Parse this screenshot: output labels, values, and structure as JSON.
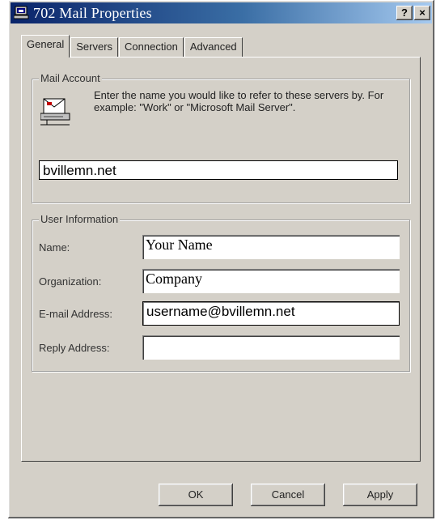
{
  "window": {
    "title": "702 Mail Properties",
    "help_button": "?",
    "close_button": "×"
  },
  "tabs": [
    {
      "label": "General",
      "active": true
    },
    {
      "label": "Servers",
      "active": false
    },
    {
      "label": "Connection",
      "active": false
    },
    {
      "label": "Advanced",
      "active": false
    }
  ],
  "mail_account": {
    "legend": "Mail Account",
    "instructions": "Enter the name you would like to refer to these servers by.  For example: \"Work\" or \"Microsoft Mail Server\".",
    "account_name": "bvillemn.net",
    "icon": "mail-server-icon"
  },
  "user_information": {
    "legend": "User Information",
    "name_label": "Name:",
    "name_value": "Your Name",
    "organization_label": "Organization:",
    "organization_value": "Company",
    "email_label": "E-mail Address:",
    "email_value": "username@bvillemn.net",
    "reply_label": "Reply Address:",
    "reply_value": ""
  },
  "buttons": {
    "ok": "OK",
    "cancel": "Cancel",
    "apply": "Apply"
  },
  "colors": {
    "titlebar_start": "#0a246a",
    "titlebar_end": "#a6caf0",
    "dialog_face": "#d4d0c8"
  }
}
